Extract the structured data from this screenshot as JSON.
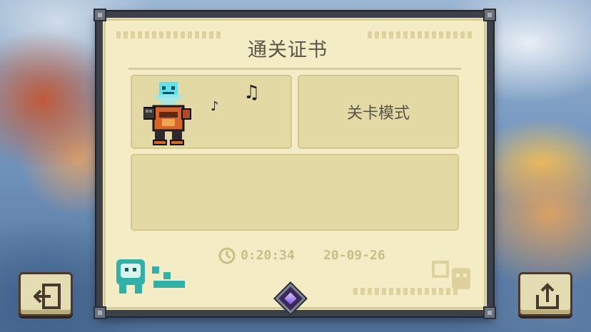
{
  "certificate": {
    "title": "通关证书",
    "mode": "关卡模式",
    "time": "0:20:34",
    "date": "20-09-26",
    "notes": [
      "♪",
      "♫"
    ]
  },
  "icons": {
    "clock": "clock-icon",
    "back": "exit-icon",
    "share": "share-icon",
    "character": "knight-robot-character",
    "gem": "purple-gem"
  },
  "colors": {
    "paper": "#f3ecc4",
    "box": "#e2d9a5",
    "frame": "#3b4049",
    "text": "#5a5548",
    "faded": "#c9bd88",
    "teal_mascot": "#2fb0a8"
  }
}
